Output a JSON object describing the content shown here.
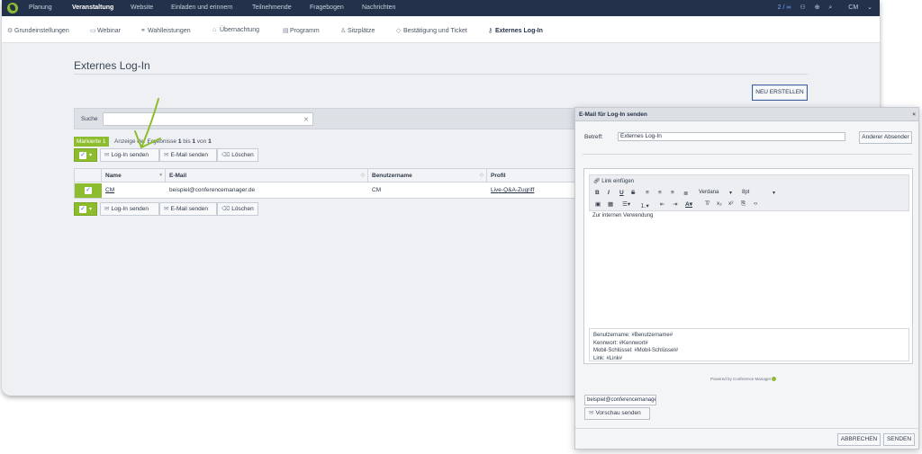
{
  "topnav": {
    "items": [
      "Planung",
      "Veranstaltung",
      "Website",
      "Einladen und erinnern",
      "Teilnehmende",
      "Fragebogen",
      "Nachrichten"
    ],
    "count": "2 / ∞",
    "user": "CM"
  },
  "subnav": {
    "items": [
      "Grundeinstellungen",
      "Webinar",
      "Wahlleistungen",
      "Übernachtung",
      "Programm",
      "Sitzplätze",
      "Bestätigung und Ticket",
      "Externes Log-In"
    ]
  },
  "page": {
    "title": "Externes Log-In",
    "new_button": "NEU ERSTELLEN"
  },
  "search": {
    "label": "Suche",
    "clear": "✕"
  },
  "selection": {
    "badge": "Markierte 1",
    "info_prefix": "Anzeige der Ergebnisse ",
    "info_from": "1",
    "info_mid": " bis ",
    "info_to": "1",
    "info_of": " von ",
    "info_total": "1"
  },
  "toolbar": {
    "send_login": "Log-In senden",
    "send_email": "E-Mail senden",
    "delete": "Löschen"
  },
  "table": {
    "columns": [
      "Name",
      "E-Mail",
      "Benutzername",
      "Profil"
    ],
    "rows": [
      {
        "name": "CM",
        "email": "beispiel@conferencemanager.de",
        "username": "CM",
        "profile": "Live-Q&A-Zugriff"
      }
    ]
  },
  "dialog": {
    "title": "E-Mail für Log-In senden",
    "close": "×",
    "subject_label": "Betreff:",
    "subject_value": "Externes Log-In",
    "other_sender": "Anderer Absender",
    "editor": {
      "insert_link": "Link einfügen",
      "font": "Verdana",
      "size": "8pt",
      "body": "Zur internen Verwendung",
      "placeholders": [
        "Benutzername: #Benutzername#",
        "Kennwort: #Kennwort#",
        "Mobil-Schlüssel: #Mobil-Schlüssel#",
        "Link: #Link#"
      ],
      "powered_by": "Powered by Conference Manager"
    },
    "preview_email": "beispiel@conferencemanager.de",
    "preview_button": "Vorschau senden",
    "cancel": "ABBRECHEN",
    "send": "SENDEN"
  },
  "colors": {
    "nav_bg": "#23324a",
    "accent_green": "#8dbd2f",
    "page_bg": "#eef0f3"
  }
}
